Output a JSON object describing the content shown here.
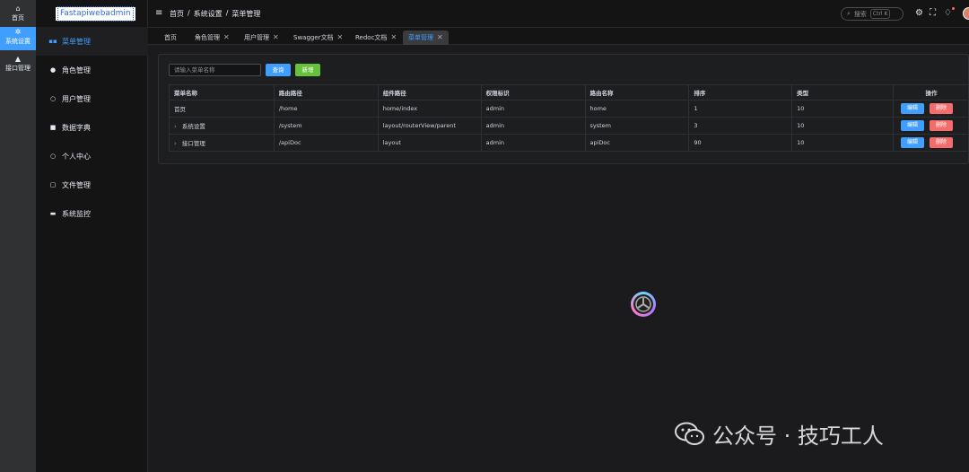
{
  "rail": {
    "items": [
      {
        "label": "首页",
        "icon": "home-icon"
      },
      {
        "label": "系统设置",
        "icon": "gear-icon"
      },
      {
        "label": "接口管理",
        "icon": "bell-icon"
      }
    ]
  },
  "sidebar": {
    "logo": "Fastapiwebadmin",
    "items": [
      {
        "label": "菜单管理",
        "icon": "grid-icon"
      },
      {
        "label": "角色管理",
        "icon": "user-icon"
      },
      {
        "label": "用户管理",
        "icon": "user-outline-icon"
      },
      {
        "label": "数据字典",
        "icon": "book-icon"
      },
      {
        "label": "个人中心",
        "icon": "person-icon"
      },
      {
        "label": "文件管理",
        "icon": "files-icon"
      },
      {
        "label": "系统监控",
        "icon": "monitor-icon"
      }
    ]
  },
  "header": {
    "breadcrumbs": [
      "首页",
      "系统设置",
      "菜单管理"
    ],
    "separator": "/",
    "search_label": "搜索",
    "search_shortcut": "Ctrl K"
  },
  "tabs": [
    {
      "label": "首页"
    },
    {
      "label": "角色管理"
    },
    {
      "label": "用户管理"
    },
    {
      "label": "Swagger文档"
    },
    {
      "label": "Redoc文档"
    },
    {
      "label": "菜单管理"
    }
  ],
  "toolbar": {
    "search_placeholder": "请输入菜单名称",
    "query_label": "查询",
    "add_label": "新增"
  },
  "table": {
    "columns": [
      "菜单名称",
      "路由路径",
      "组件路径",
      "权限标识",
      "路由名称",
      "排序",
      "类型",
      "操作"
    ],
    "rows": [
      {
        "name": "首页",
        "path": "/home",
        "component": "home/index",
        "perm": "admin",
        "route_name": "home",
        "sort": "1",
        "type": "10"
      },
      {
        "name": "系统设置",
        "path": "/system",
        "component": "layout/routerView/parent",
        "perm": "admin",
        "route_name": "system",
        "sort": "3",
        "type": "10"
      },
      {
        "name": "接口管理",
        "path": "/apiDoc",
        "component": "layout",
        "perm": "admin",
        "route_name": "apiDoc",
        "sort": "90",
        "type": "10"
      }
    ],
    "edit_label": "编辑",
    "delete_label": "删除"
  },
  "watermark": "公众号 · 技巧工人",
  "colors": {
    "primary": "#409eff",
    "success": "#67c23a",
    "danger": "#f56c6c"
  }
}
